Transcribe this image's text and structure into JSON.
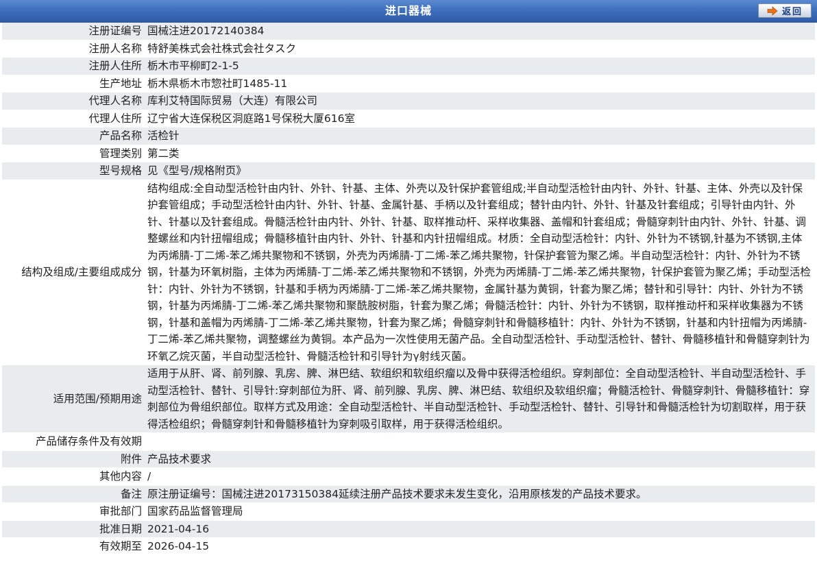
{
  "header": {
    "title": "进口器械",
    "back_label": "返回",
    "back_icon": "arrow-right-icon",
    "colors": {
      "title_bar": "#3f6fbd",
      "row_alt": "#e9ecef",
      "arrow": "#e8731c"
    }
  },
  "rows": [
    {
      "label": "注册证编号",
      "value": "国械注进20172140384"
    },
    {
      "label": "注册人名称",
      "value": "特舒美株式会社株式会社タスク"
    },
    {
      "label": "注册人住所",
      "value": "栃木市平柳町2-1-5"
    },
    {
      "label": "生产地址",
      "value": "栃木県栃木市惣社町1485-11"
    },
    {
      "label": "代理人名称",
      "value": "库利艾特国际贸易（大连）有限公司"
    },
    {
      "label": "代理人住所",
      "value": "辽宁省大连保税区洞庭路1号保税大厦616室"
    },
    {
      "label": "产品名称",
      "value": "活检针"
    },
    {
      "label": "管理类别",
      "value": "第二类"
    },
    {
      "label": "型号规格",
      "value": "见《型号/规格附页》"
    },
    {
      "label": "结构及组成/主要组成成分",
      "value": "结构组成:全自动型活检针由内针、外针、针基、主体、外壳以及针保护套管组成;半自动型活检针由内针、外针、针基、主体、外壳以及针保护套管组成；手动型活检针由内针、外针、针基、金属针基、手柄以及针套组成；替针由内针、外针、针基及针套组成；引导针由内针、外针、针基以及针套组成。骨髓活检针由内针、外针、针基、取样推动杆、采样收集器、盖帽和针套组成；骨髓穿刺针由内针、外针、针基、调整螺丝和内针扭帽组成；骨髓移植针由内针、外针、针基和内针扭帽组成。材质：全自动型活检针：内针、外针为不锈钢,针基为不锈钢,主体为丙烯腈-丁二烯-苯乙烯共聚物和不锈钢，外壳为丙烯腈-丁二烯-苯乙烯共聚物，针保护套管为聚乙烯。半自动型活检针：内针、外针为不锈钢，针基为环氧树脂，主体为丙烯腈-丁二烯-苯乙烯共聚物和不锈钢，外壳为丙烯腈-丁二烯-苯乙烯共聚物，针保护套管为聚乙烯；手动型活检针：内针、外针为不锈钢，针基和手柄为丙烯腈-丁二烯-苯乙烯共聚物，金属针基为黄铜，针套为聚乙烯；替针和引导针：内针、外针为不锈钢，针基为丙烯腈-丁二烯-苯乙烯共聚物和聚酰胺树脂，针套为聚乙烯；骨髓活检针：内针、外针为不锈钢，取样推动杆和采样收集器为不锈钢，针基和盖帽为丙烯腈-丁二烯-苯乙烯共聚物，针套为聚乙烯；骨髓穿刺针和骨髓移植针：内针、外针为不锈钢，针基和内针扭帽为丙烯腈-丁二烯-苯乙烯共聚物，调整螺丝为黄铜。本产品为一次性使用无菌产品。全自动型活检针、手动型活检针、替针、骨髓移植针和骨髓穿刺针为环氧乙烷灭菌，半自动型活检针、骨髓活检针和引导针为γ射线灭菌。"
    },
    {
      "label": "适用范围/预期用途",
      "value": "适用于从肝、肾、前列腺、乳房、脾、淋巴结、软组织和软组织瘤以及骨中获得活检组织。穿刺部位：全自动型活检针、半自动型活检针、手动型活检针、替针、引导针:穿刺部位为肝、肾、前列腺、乳房、脾、淋巴结、软组织及软组织瘤；骨髓活检针、骨髓穿刺针、骨髓移植针：穿刺部位为骨组织部位。取样方式及用途：全自动型活检针、半自动型活检针、手动型活检针、替针、引导针和骨髓活检针为切割取样，用于获得活检组织；骨髓穿刺针和骨髓移植针为穿刺吸引取样，用于获得活检组织。"
    },
    {
      "label": "产品储存条件及有效期",
      "value": ""
    },
    {
      "label": "附件",
      "value": "产品技术要求"
    },
    {
      "label": "其他内容",
      "value": "/"
    },
    {
      "label": "备注",
      "value": "原注册证编号：国械注进20173150384延续注册产品技术要求未发生变化，沿用原核发的产品技术要求。"
    },
    {
      "label": "审批部门",
      "value": "国家药品监督管理局"
    },
    {
      "label": "批准日期",
      "value": "2021-04-16"
    },
    {
      "label": "有效期至",
      "value": "2026-04-15"
    }
  ]
}
